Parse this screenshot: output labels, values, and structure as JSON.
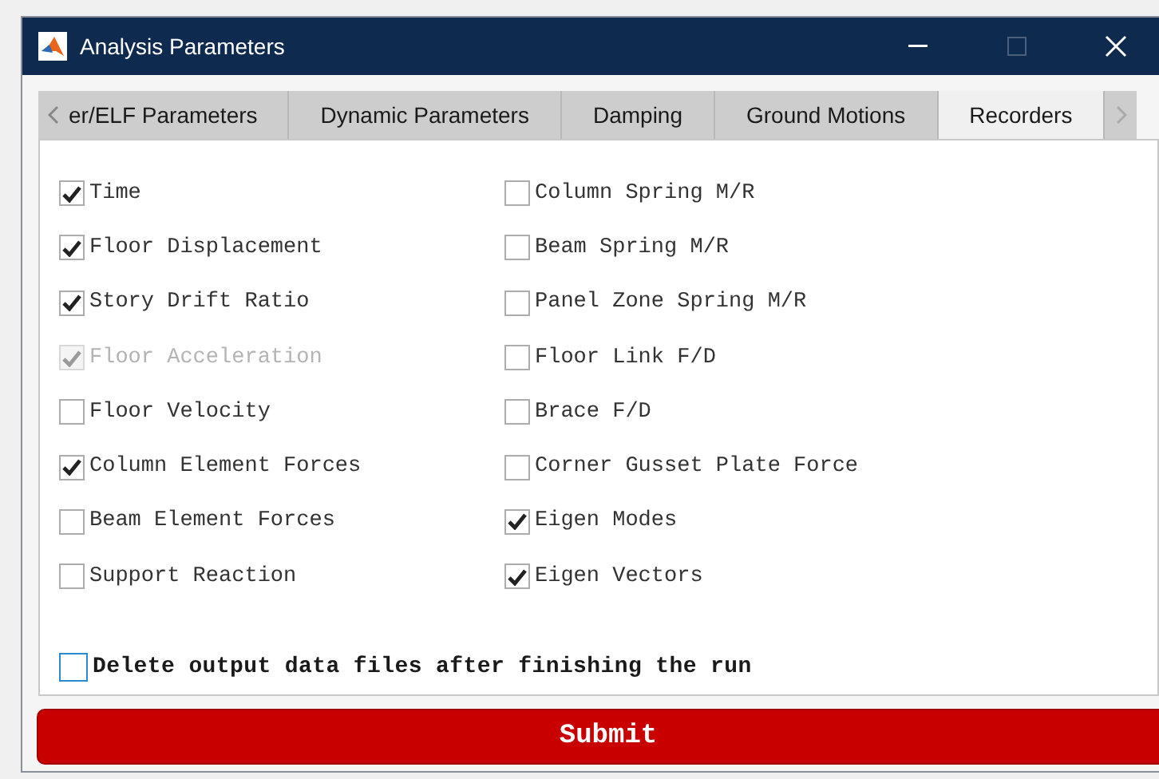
{
  "window": {
    "title": "Analysis Parameters"
  },
  "tabs": [
    {
      "label": "er/ELF Parameters",
      "selected": false
    },
    {
      "label": "Dynamic Parameters",
      "selected": false
    },
    {
      "label": "Damping",
      "selected": false
    },
    {
      "label": "Ground Motions",
      "selected": false
    },
    {
      "label": "Recorders",
      "selected": true
    }
  ],
  "recorders": {
    "left": [
      {
        "label": "Time",
        "checked": true,
        "disabled": false
      },
      {
        "label": "Floor Displacement",
        "checked": true,
        "disabled": false
      },
      {
        "label": "Story Drift Ratio",
        "checked": true,
        "disabled": false
      },
      {
        "label": "Floor Acceleration",
        "checked": true,
        "disabled": true
      },
      {
        "label": "Floor Velocity",
        "checked": false,
        "disabled": false
      },
      {
        "label": "Column Element Forces",
        "checked": true,
        "disabled": false
      },
      {
        "label": "Beam Element Forces",
        "checked": false,
        "disabled": false
      },
      {
        "label": "Support Reaction",
        "checked": false,
        "disabled": false
      }
    ],
    "right": [
      {
        "label": "Column Spring M/R",
        "checked": false,
        "disabled": false
      },
      {
        "label": "Beam Spring M/R",
        "checked": false,
        "disabled": false
      },
      {
        "label": "Panel Zone Spring M/R",
        "checked": false,
        "disabled": false
      },
      {
        "label": "Floor Link F/D",
        "checked": false,
        "disabled": false
      },
      {
        "label": "Brace F/D",
        "checked": false,
        "disabled": false
      },
      {
        "label": "Corner Gusset Plate Force",
        "checked": false,
        "disabled": false
      },
      {
        "label": "Eigen Modes",
        "checked": true,
        "disabled": false
      },
      {
        "label": "Eigen Vectors",
        "checked": true,
        "disabled": false
      }
    ]
  },
  "delete_files": {
    "label": "Delete output data files after finishing the run",
    "checked": false
  },
  "submit": {
    "label": "Submit"
  }
}
